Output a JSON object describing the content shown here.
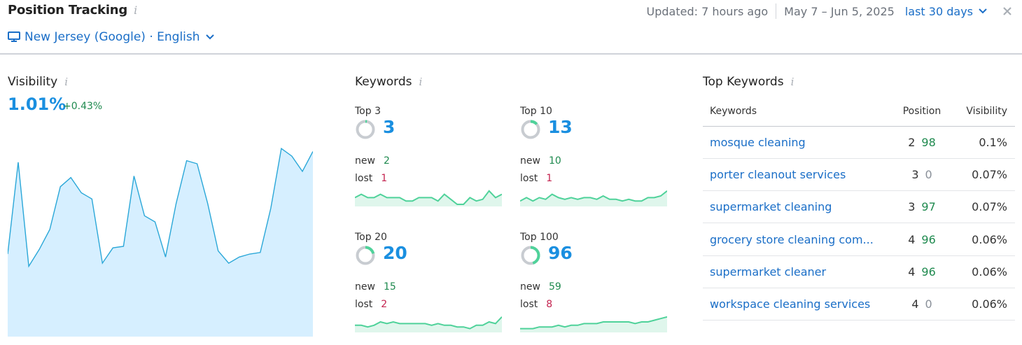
{
  "header": {
    "title": "Position Tracking",
    "info": "i",
    "location": "New Jersey (Google) · English",
    "updated": "Updated: 7 hours ago",
    "date_range": "May 7 – Jun 5, 2025",
    "period": "last 30 days"
  },
  "visibility": {
    "title": "Visibility",
    "value": "1.01%",
    "delta": "+0.43%",
    "series": [
      0.54,
      1.14,
      0.46,
      0.57,
      0.7,
      0.98,
      1.04,
      0.94,
      0.9,
      0.48,
      0.58,
      0.59,
      1.05,
      0.79,
      0.75,
      0.52,
      0.87,
      1.15,
      1.13,
      0.87,
      0.56,
      0.48,
      0.52,
      0.54,
      0.55,
      0.84,
      1.23,
      1.18,
      1.08,
      1.21
    ],
    "color": "#2aa7d8",
    "fill": "#d6efff"
  },
  "keywords": {
    "title": "Keywords",
    "new_label": "new",
    "lost_label": "lost",
    "blocks": [
      {
        "label": "Top 3",
        "value": "3",
        "new": "2",
        "lost": "1",
        "share": 0.03,
        "spark": [
          4,
          6,
          4,
          4,
          6,
          4,
          4,
          4,
          2,
          2,
          4,
          4,
          4,
          2,
          6,
          3,
          0,
          0,
          4,
          2,
          3,
          8,
          4,
          6
        ]
      },
      {
        "label": "Top 10",
        "value": "13",
        "new": "10",
        "lost": "1",
        "share": 0.135,
        "spark": [
          2,
          4,
          2,
          4,
          3,
          6,
          4,
          3,
          4,
          3,
          4,
          4,
          3,
          5,
          3,
          3,
          2,
          3,
          2,
          2,
          4,
          4,
          5,
          8
        ]
      },
      {
        "label": "Top 20",
        "value": "20",
        "new": "15",
        "lost": "2",
        "share": 0.21,
        "spark": [
          3,
          3,
          2,
          3,
          5,
          4,
          5,
          4,
          4,
          4,
          4,
          4,
          3,
          4,
          3,
          3,
          2,
          2,
          1,
          3,
          3,
          5,
          4,
          8
        ]
      },
      {
        "label": "Top 100",
        "value": "96",
        "new": "59",
        "lost": "8",
        "share": 0.45,
        "spark": [
          1,
          1,
          1,
          2,
          2,
          2,
          3,
          2,
          3,
          3,
          4,
          4,
          4,
          5,
          5,
          5,
          5,
          5,
          4,
          5,
          5,
          6,
          7,
          8
        ]
      }
    ]
  },
  "top_keywords": {
    "title": "Top Keywords",
    "columns": [
      "Keywords",
      "Position",
      "Visibility"
    ],
    "rows": [
      {
        "keyword": "mosque cleaning",
        "position": "2",
        "diff": "98",
        "visibility": "0.1%"
      },
      {
        "keyword": "porter cleanout services",
        "position": "3",
        "diff": "0",
        "visibility": "0.07%"
      },
      {
        "keyword": "supermarket cleaning",
        "position": "3",
        "diff": "97",
        "visibility": "0.07%"
      },
      {
        "keyword": "grocery store cleaning com...",
        "position": "4",
        "diff": "96",
        "visibility": "0.06%"
      },
      {
        "keyword": "supermarket cleaner",
        "position": "4",
        "diff": "96",
        "visibility": "0.06%"
      },
      {
        "keyword": "workspace cleaning services",
        "position": "4",
        "diff": "0",
        "visibility": "0.06%"
      }
    ]
  },
  "colors": {
    "accent": "#1a8fe0",
    "link": "#1a6ec7",
    "positive": "#1f8a4f",
    "negative": "#c4234f",
    "spark_line": "#4fd29a",
    "spark_fill": "#dff6ec",
    "donut_track": "#c8ccd1",
    "donut_fill": "#4fd29a"
  }
}
